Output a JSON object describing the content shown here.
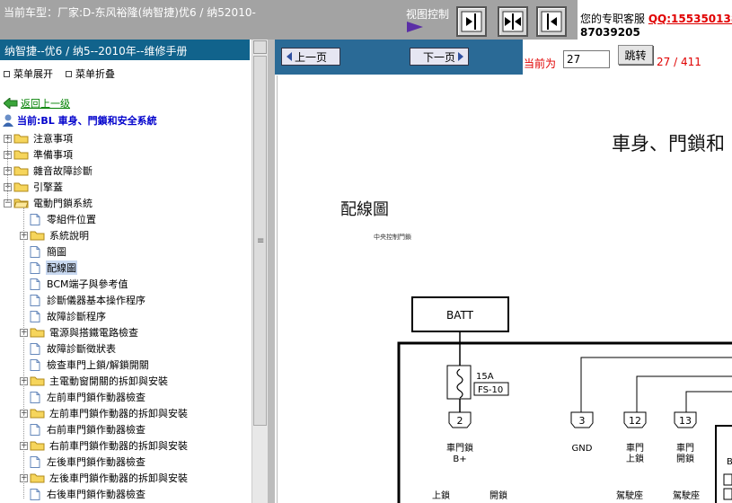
{
  "header": {
    "car_title": "当前车型：厂家:D-东风裕隆(纳智捷)优6 / 纳52010-",
    "view_control": "视图控制",
    "view_buttons": [
      "collapse-right-icon",
      "split-center-icon",
      "collapse-left-icon"
    ],
    "support_text": "您的专职客服",
    "support_qq": "QQ:1553501387039205"
  },
  "sidebar": {
    "title": "纳智捷--优6 / 纳5--2010年--维修手册",
    "expand_label": "菜单展开",
    "collapse_label": "菜单折叠",
    "back_label": "返回上一级",
    "current_label": "当前:BL 車身、門鎖和安全系統",
    "tree": [
      {
        "label": "注意事項",
        "type": "folder",
        "level": 0,
        "expandable": true
      },
      {
        "label": "準備事項",
        "type": "folder",
        "level": 0,
        "expandable": true
      },
      {
        "label": "雜音故障診斷",
        "type": "folder",
        "level": 0,
        "expandable": true
      },
      {
        "label": "引擎蓋",
        "type": "folder",
        "level": 0,
        "expandable": true
      },
      {
        "label": "電動門鎖系統",
        "type": "folder-open",
        "level": 0,
        "expandable": true,
        "expanded": true
      },
      {
        "label": "零組件位置",
        "type": "doc",
        "level": 1
      },
      {
        "label": "系統說明",
        "type": "folder",
        "level": 1,
        "expandable": true
      },
      {
        "label": "簡圖",
        "type": "doc",
        "level": 1
      },
      {
        "label": "配線圖",
        "type": "doc",
        "level": 1,
        "selected": true
      },
      {
        "label": "BCM端子與參考值",
        "type": "doc",
        "level": 1
      },
      {
        "label": "診斷儀器基本操作程序",
        "type": "doc",
        "level": 1
      },
      {
        "label": "故障診斷程序",
        "type": "doc",
        "level": 1
      },
      {
        "label": "電源與搭鐵電路檢查",
        "type": "folder",
        "level": 1,
        "expandable": true
      },
      {
        "label": "故障診斷徵狀表",
        "type": "doc",
        "level": 1
      },
      {
        "label": "檢查車門上鎖/解鎖開關",
        "type": "doc",
        "level": 1
      },
      {
        "label": "主電動窗開關的拆卸與安裝",
        "type": "folder",
        "level": 1,
        "expandable": true
      },
      {
        "label": "左前車門鎖作動器檢查",
        "type": "doc",
        "level": 1
      },
      {
        "label": "左前車門鎖作動器的拆卸與安裝",
        "type": "folder",
        "level": 1,
        "expandable": true
      },
      {
        "label": "右前車門鎖作動器檢查",
        "type": "doc",
        "level": 1
      },
      {
        "label": "右前車門鎖作動器的拆卸與安裝",
        "type": "folder",
        "level": 1,
        "expandable": true
      },
      {
        "label": "左後車門鎖作動器檢查",
        "type": "doc",
        "level": 1
      },
      {
        "label": "左後車門鎖作動器的拆卸與安裝",
        "type": "folder",
        "level": 1,
        "expandable": true
      },
      {
        "label": "右後車門鎖作動器檢查",
        "type": "doc",
        "level": 1
      }
    ]
  },
  "pager": {
    "prev_label": "上一页",
    "next_label": "下一页",
    "current_label": "当前为",
    "current_page": "27",
    "go_label": "跳转",
    "total": "27 / 411"
  },
  "document": {
    "heading": "車身、門鎖和",
    "section_title": "配線圖",
    "subtitle": "中央控制門鎖",
    "diagram": {
      "batt": "BATT",
      "fuse_rating": "15A",
      "fuse_id": "FS-10",
      "pins": [
        {
          "num": "2",
          "label1": "車門鎖",
          "label2": "B+"
        },
        {
          "num": "3",
          "label1": "GND",
          "label2": ""
        },
        {
          "num": "12",
          "label1": "車門",
          "label2": "上鎖"
        },
        {
          "num": "13",
          "label1": "車門",
          "label2": "開鎖"
        }
      ],
      "bottom_labels": [
        "上鎖",
        "開鎖",
        "駕駛座",
        "駕駛座"
      ],
      "partial_label": "B"
    }
  },
  "colors": {
    "topbar": "#a3a3a3",
    "sidebar_title": "#11638c",
    "navbar": "#2a6a96",
    "qq_red": "#e00000",
    "link_green": "#008000",
    "current_blue": "#0000cc"
  }
}
